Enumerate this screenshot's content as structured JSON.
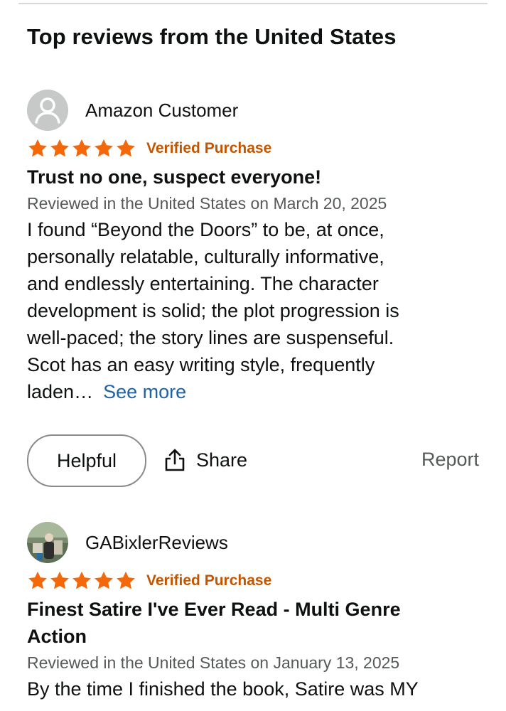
{
  "section": {
    "title": "Top reviews from the United States"
  },
  "reviews": [
    {
      "author": "Amazon Customer",
      "avatar": "default-user-icon",
      "stars": 5,
      "verified": "Verified Purchase",
      "title": "Trust no one, suspect everyone!",
      "date": "Reviewed in the United States on March 20, 2025",
      "body_lines": [
        "I found “Beyond the Doors” to be, at once,",
        "personally relatable, culturally informative,",
        "and endlessly entertaining. The character",
        "development is solid; the plot progression is",
        "well-paced; the story lines are suspenseful.",
        "Scot has an easy writing style, frequently",
        "laden…"
      ],
      "see_more": "See more",
      "actions": {
        "helpful": "Helpful",
        "share": "Share",
        "report": "Report"
      }
    },
    {
      "author": "GABixlerReviews",
      "avatar": "user-photo",
      "stars": 5,
      "verified": "Verified Purchase",
      "title_lines": [
        "Finest Satire I've Ever Read - Multi Genre",
        "Action"
      ],
      "date": "Reviewed in the United States on January 13, 2025",
      "body_lines": [
        "By the time I finished the book, Satire was MY"
      ]
    }
  ],
  "colors": {
    "star": "#f3680b",
    "verified": "#c45500",
    "link": "#2162a1",
    "muted": "#565959"
  }
}
